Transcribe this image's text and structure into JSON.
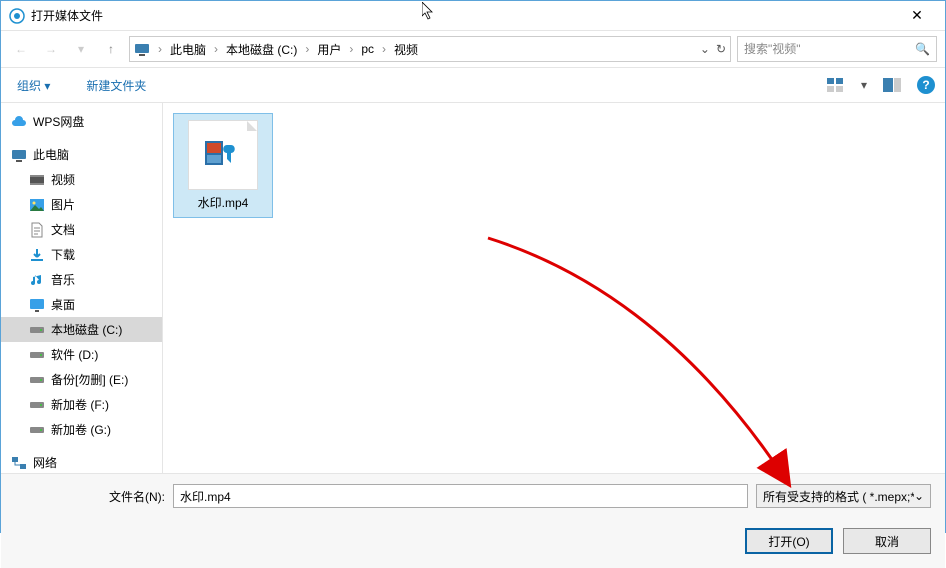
{
  "window": {
    "title": "打开媒体文件"
  },
  "breadcrumb": {
    "items": [
      "此电脑",
      "本地磁盘 (C:)",
      "用户",
      "pc",
      "视频"
    ]
  },
  "search": {
    "placeholder": "搜索\"视频\""
  },
  "toolbar": {
    "organize": "组织",
    "new_folder": "新建文件夹"
  },
  "sidebar": {
    "wps": "WPS网盘",
    "this_pc": "此电脑",
    "items": [
      {
        "label": "视频",
        "icon": "video"
      },
      {
        "label": "图片",
        "icon": "picture"
      },
      {
        "label": "文档",
        "icon": "document"
      },
      {
        "label": "下载",
        "icon": "download"
      },
      {
        "label": "音乐",
        "icon": "music"
      },
      {
        "label": "桌面",
        "icon": "desktop"
      },
      {
        "label": "本地磁盘 (C:)",
        "icon": "drive",
        "selected": true
      },
      {
        "label": "软件 (D:)",
        "icon": "drive"
      },
      {
        "label": "备份[勿删] (E:)",
        "icon": "drive"
      },
      {
        "label": "新加卷 (F:)",
        "icon": "drive"
      },
      {
        "label": "新加卷 (G:)",
        "icon": "drive"
      }
    ],
    "network": "网络"
  },
  "files": {
    "items": [
      {
        "name": "水印.mp4",
        "selected": true
      }
    ]
  },
  "footer": {
    "filename_label": "文件名(N):",
    "filename_value": "水印.mp4",
    "filter_label": "所有受支持的格式 ( *.mepx;*.",
    "open_label": "打开(O)",
    "cancel_label": "取消"
  }
}
